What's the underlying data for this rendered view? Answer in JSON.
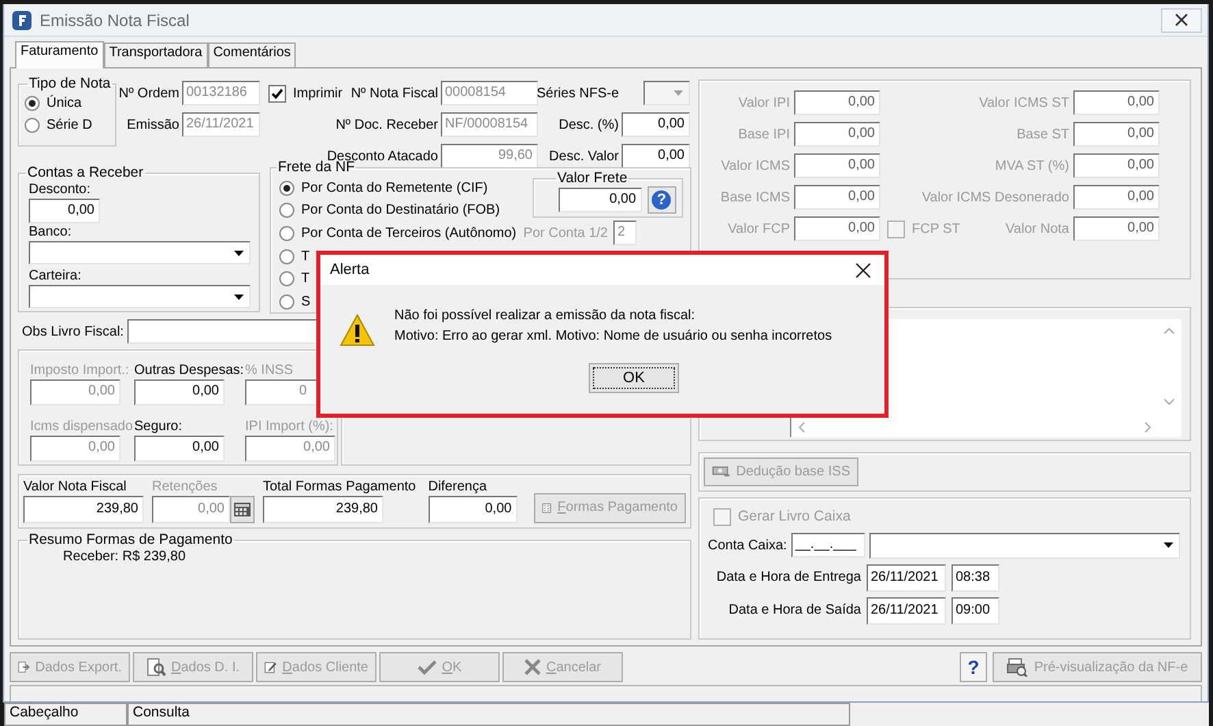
{
  "window": {
    "title": "Emissão Nota Fiscal"
  },
  "tabs": [
    {
      "label": "Faturamento",
      "selected": true
    },
    {
      "label": "Transportadora",
      "selected": false
    },
    {
      "label": "Comentários",
      "selected": false
    }
  ],
  "tipo_nota": {
    "title": "Tipo de Nota",
    "options": [
      {
        "label": "Única",
        "selected": true
      },
      {
        "label": "Série D",
        "selected": false
      }
    ]
  },
  "header": {
    "ordem": {
      "label": "Nº Ordem",
      "value": "00132186",
      "disabled": true
    },
    "emissao": {
      "label": "Emissão",
      "value": "26/11/2021",
      "disabled": true
    },
    "imprimir": {
      "label": "Imprimir",
      "checked": true
    },
    "nota_fiscal": {
      "label": "Nº Nota Fiscal",
      "value": "00008154",
      "disabled": true
    },
    "doc_receber": {
      "label": "Nº Doc. Receber",
      "value": "NF/00008154",
      "disabled": true
    },
    "desconto_atacado": {
      "label": "Desconto Atacado",
      "value": "99,60",
      "disabled": true
    },
    "series_nfse": {
      "label": "Séries NFS-e",
      "disabled": true
    },
    "desc_pct": {
      "label": "Desc. (%)",
      "value": "0,00",
      "disabled": false
    },
    "desc_valor": {
      "label": "Desc. Valor",
      "value": "0,00",
      "disabled": false
    }
  },
  "contas": {
    "title": "Contas a Receber",
    "desconto": {
      "label": "Desconto:",
      "value": "0,00"
    },
    "banco": {
      "label": "Banco:"
    },
    "carteira": {
      "label": "Carteira:"
    }
  },
  "frete": {
    "title": "Frete da NF",
    "options": [
      {
        "label": "Por Conta do Remetente (CIF)",
        "selected": true
      },
      {
        "label": "Por Conta do Destinatário (FOB)",
        "selected": false
      },
      {
        "label": "Por Conta de Terceiros (Autônomo)",
        "selected": false
      },
      {
        "label": "T",
        "selected": false
      },
      {
        "label": "T",
        "selected": false
      },
      {
        "label": "S",
        "selected": false
      }
    ],
    "valor_frete": {
      "title": "Valor Frete",
      "value": "0,00",
      "help": "?"
    },
    "por_conta": {
      "label": "Por Conta 1/2",
      "value": "2"
    }
  },
  "obs_livro_fiscal": {
    "label": "Obs Livro Fiscal:"
  },
  "impostos": [
    {
      "label": "Imposto Import.:",
      "value": "0,00",
      "disabled": true
    },
    {
      "label": "Outras Despesas:",
      "value": "0,00",
      "disabled": false
    },
    {
      "label": "% INSS",
      "value": "0",
      "disabled": true
    },
    {
      "label": "Icms dispensado",
      "value": "0,00",
      "disabled": true
    },
    {
      "label": "Seguro:",
      "value": "0,00",
      "disabled": false
    },
    {
      "label": "IPI Import (%):",
      "value": "0,00",
      "disabled": true
    }
  ],
  "totais": {
    "fields": [
      {
        "label": "Valor Nota Fiscal",
        "value": "239,80",
        "disabled": false
      },
      {
        "label": "Retenções",
        "value": "0,00",
        "disabled": true
      },
      {
        "label": "Total Formas Pagamento",
        "value": "239,80",
        "disabled": false
      },
      {
        "label": "Diferença",
        "value": "0,00",
        "disabled": false
      }
    ],
    "formas_button": {
      "label": "Formas Pagamento",
      "disabled": true
    }
  },
  "resumo": {
    "title": "Resumo Formas de Pagamento",
    "text": "Receber: R$ 239,80"
  },
  "taxes": {
    "left": [
      {
        "label": "Valor IPI",
        "value": "0,00"
      },
      {
        "label": "Base IPI",
        "value": "0,00"
      },
      {
        "label": "Valor ICMS",
        "value": "0,00"
      },
      {
        "label": "Base ICMS",
        "value": "0,00"
      },
      {
        "label": "Valor FCP",
        "value": "0,00"
      }
    ],
    "right": [
      {
        "label": "Valor ICMS ST",
        "value": "0,00"
      },
      {
        "label": "Base ST",
        "value": "0,00"
      },
      {
        "label": "MVA ST (%)",
        "value": "0,00"
      },
      {
        "label": "Valor ICMS Desonerado",
        "value": "0,00"
      },
      {
        "label": "Valor Nota",
        "value": "0,00"
      }
    ],
    "fcp_st": {
      "label": "FCP ST",
      "checked": false
    }
  },
  "deducao_button": {
    "label": "Dedução base ISS",
    "disabled": true
  },
  "livro_caixa": {
    "gerar": {
      "label": "Gerar Livro Caixa",
      "checked": false,
      "disabled": true
    },
    "conta_caixa": {
      "label": "Conta Caixa:",
      "value": "__.__.___"
    },
    "entrega": {
      "label": "Data e Hora de Entrega",
      "date": "26/11/2021",
      "time": "08:38"
    },
    "saida": {
      "label": "Data e Hora de Saída",
      "date": "26/11/2021",
      "time": "09:00"
    }
  },
  "buttons": [
    {
      "label": "Dados Export.",
      "kind": "export",
      "disabled": true
    },
    {
      "label": "Dados D. I.",
      "kind": "search",
      "disabled": true
    },
    {
      "label": "Dados Cliente",
      "kind": "edit",
      "disabled": true
    },
    {
      "label": "OK",
      "kind": "check",
      "disabled": true
    },
    {
      "label": "Cancelar",
      "kind": "cross",
      "disabled": true
    }
  ],
  "help_button": {
    "label": "?"
  },
  "preview_button": {
    "label": "Pré-visualização da NF-e",
    "disabled": true
  },
  "background_window": {
    "columns": [
      "Cabeçalho",
      "Consulta"
    ]
  },
  "alert": {
    "title": "Alerta",
    "lines": [
      "Não foi possível realizar a emissão da nota fiscal:",
      "Motivo: Erro ao gerar xml. Motivo: Nome de usuário ou senha incorretos"
    ],
    "button": "OK"
  }
}
